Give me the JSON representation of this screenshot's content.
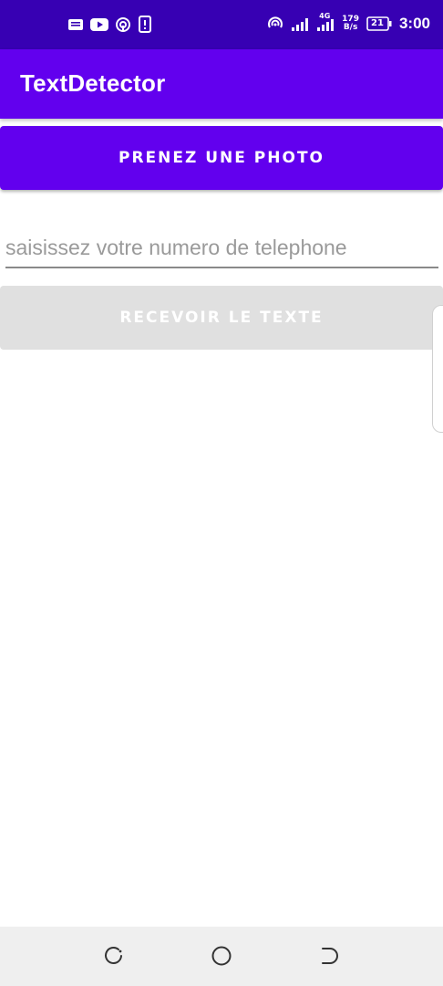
{
  "status_bar": {
    "left_icons": [
      "notification-icon",
      "youtube-icon",
      "hotspot-icon",
      "device-alert-icon"
    ],
    "right_icons": [
      "hotspot-icon",
      "signal-icon",
      "signal-4g-icon",
      "battery-icon"
    ],
    "network_label": "4G",
    "net_speed_value": "179",
    "net_speed_unit": "B/s",
    "battery_level": "21",
    "time": "3:00"
  },
  "app_bar": {
    "title": "TextDetector"
  },
  "main": {
    "photo_button_label": "PRENEZ UNE PHOTO",
    "phone_input_placeholder": "saisissez votre numero de telephone",
    "phone_input_value": "",
    "receive_text_button_label": "RECEVOIR LE TEXTE",
    "receive_text_button_enabled": false
  },
  "nav_bar": {
    "buttons": [
      "recent-apps-icon",
      "home-icon",
      "back-icon"
    ]
  },
  "colors": {
    "status_bar": "#3700b3",
    "primary": "#6200ee",
    "disabled_button": "#e0e0e0",
    "nav_bar": "#efefef"
  }
}
